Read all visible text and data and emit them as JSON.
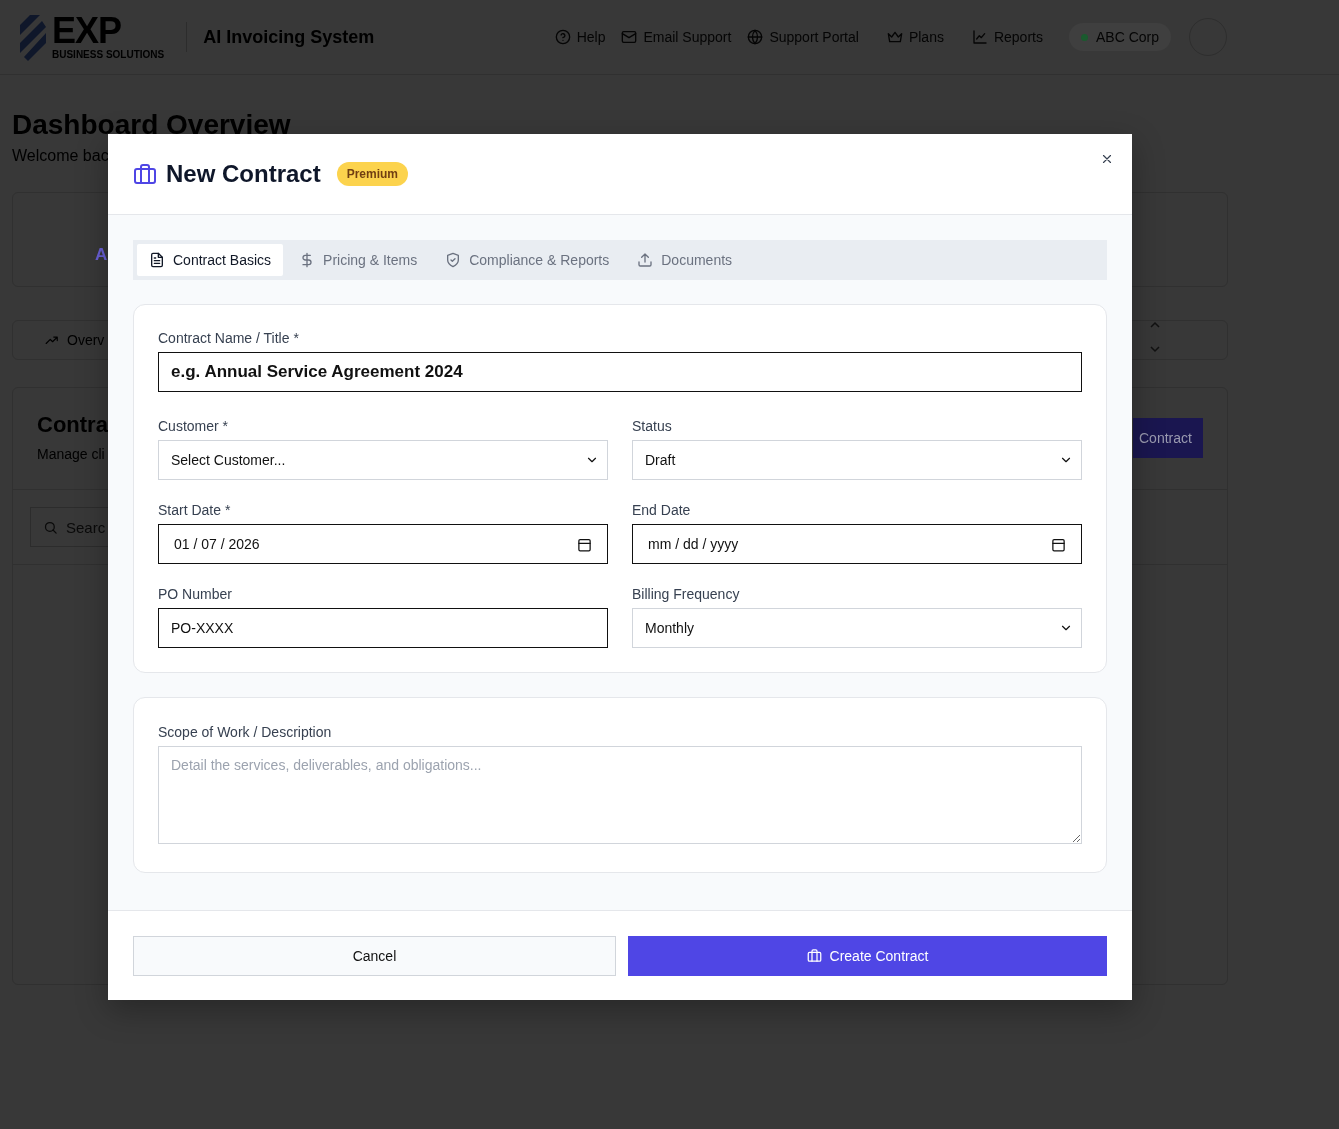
{
  "header": {
    "logo": {
      "wordmark": "EXP",
      "tagline": "BUSINESS SOLUTIONS"
    },
    "app_title": "AI Invoicing System",
    "nav": [
      {
        "label": "Help"
      },
      {
        "label": "Email Support"
      },
      {
        "label": "Support Portal"
      },
      {
        "label": "Plans"
      },
      {
        "label": "Reports"
      }
    ],
    "company": {
      "label": "ABC Corp",
      "color": "#1a5a2e"
    }
  },
  "page": {
    "title": "Dashboard Overview",
    "subtitle": "Welcome bac",
    "stat_letter": "A",
    "tab": "Overv",
    "section": {
      "title": "Contra",
      "subtitle": "Manage cli",
      "button": "Contract",
      "search_placeholder": "Searc"
    }
  },
  "modal": {
    "title": "New Contract",
    "badge": "Premium",
    "tabs": [
      {
        "label": "Contract Basics",
        "selected": true
      },
      {
        "label": "Pricing & Items",
        "selected": false
      },
      {
        "label": "Compliance & Reports",
        "selected": false
      },
      {
        "label": "Documents",
        "selected": false
      }
    ],
    "name_field": {
      "label": "Contract Name / Title *",
      "value": "e.g. Annual Service Agreement 2024"
    },
    "fields": [
      {
        "kind": "select",
        "label": "Customer *",
        "value": "Select Customer..."
      },
      {
        "kind": "select",
        "label": "Status",
        "value": "Draft"
      },
      {
        "kind": "date",
        "label": "Start Date *",
        "value": "01 / 07 / 2026"
      },
      {
        "kind": "date",
        "label": "End Date",
        "placeholder": "mm / dd / yyyy"
      },
      {
        "kind": "text",
        "label": "PO Number",
        "value": "PO-XXXX"
      },
      {
        "kind": "select",
        "label": "Billing Frequency",
        "value": "Monthly"
      }
    ],
    "description": {
      "label": "Scope of Work / Description",
      "placeholder": "Detail the services, deliverables, and obligations..."
    },
    "buttons": [
      {
        "label": "Cancel",
        "kind": "secondary"
      },
      {
        "label": "Create Contract",
        "kind": "primary"
      }
    ]
  }
}
